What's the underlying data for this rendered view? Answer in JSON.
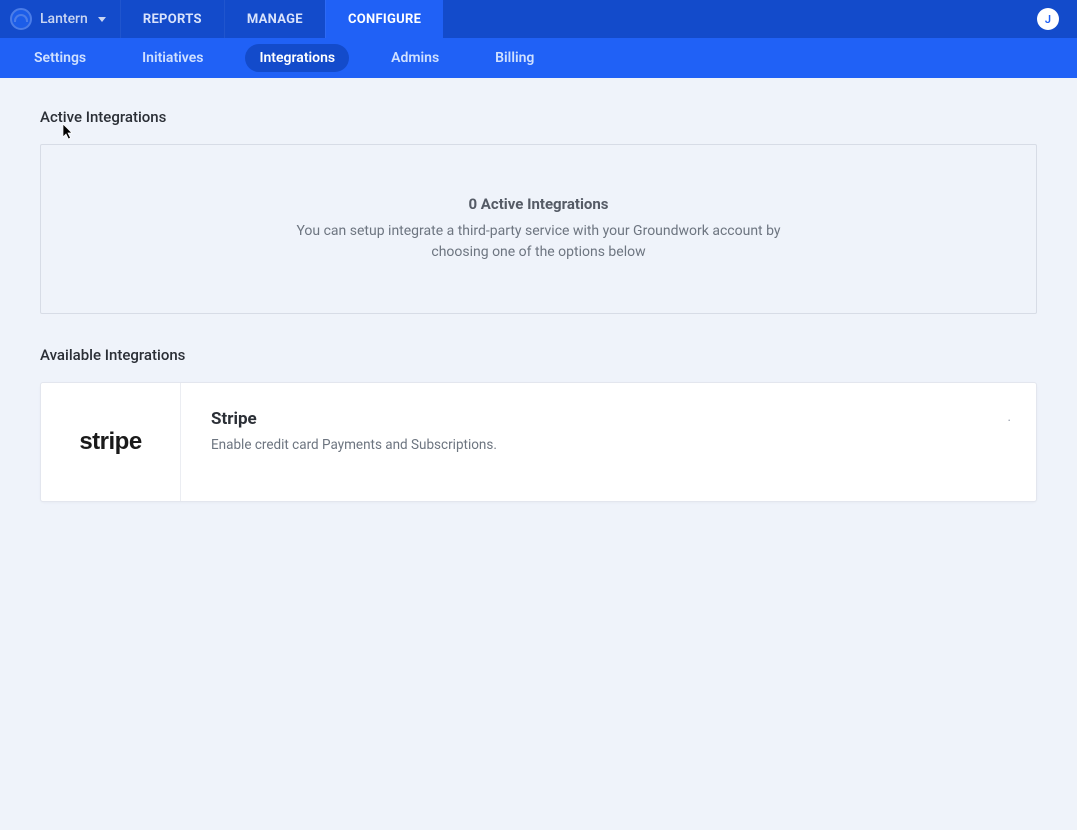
{
  "brand": {
    "name": "Lantern"
  },
  "topnav": {
    "items": [
      "REPORTS",
      "MANAGE",
      "CONFIGURE"
    ],
    "activeIndex": 2
  },
  "avatar": {
    "initial": "J"
  },
  "subnav": {
    "items": [
      "Settings",
      "Initiatives",
      "Integrations",
      "Admins",
      "Billing"
    ],
    "activeIndex": 2
  },
  "sections": {
    "active": {
      "title": "Active Integrations",
      "emptyTitle": "0 Active Integrations",
      "emptyText": "You can setup integrate a third-party service with your Groundwork account by choosing one of the options below"
    },
    "available": {
      "title": "Available Integrations",
      "items": [
        {
          "logoText": "stripe",
          "name": "Stripe",
          "description": "Enable credit card Payments and Subscriptions."
        }
      ]
    }
  }
}
